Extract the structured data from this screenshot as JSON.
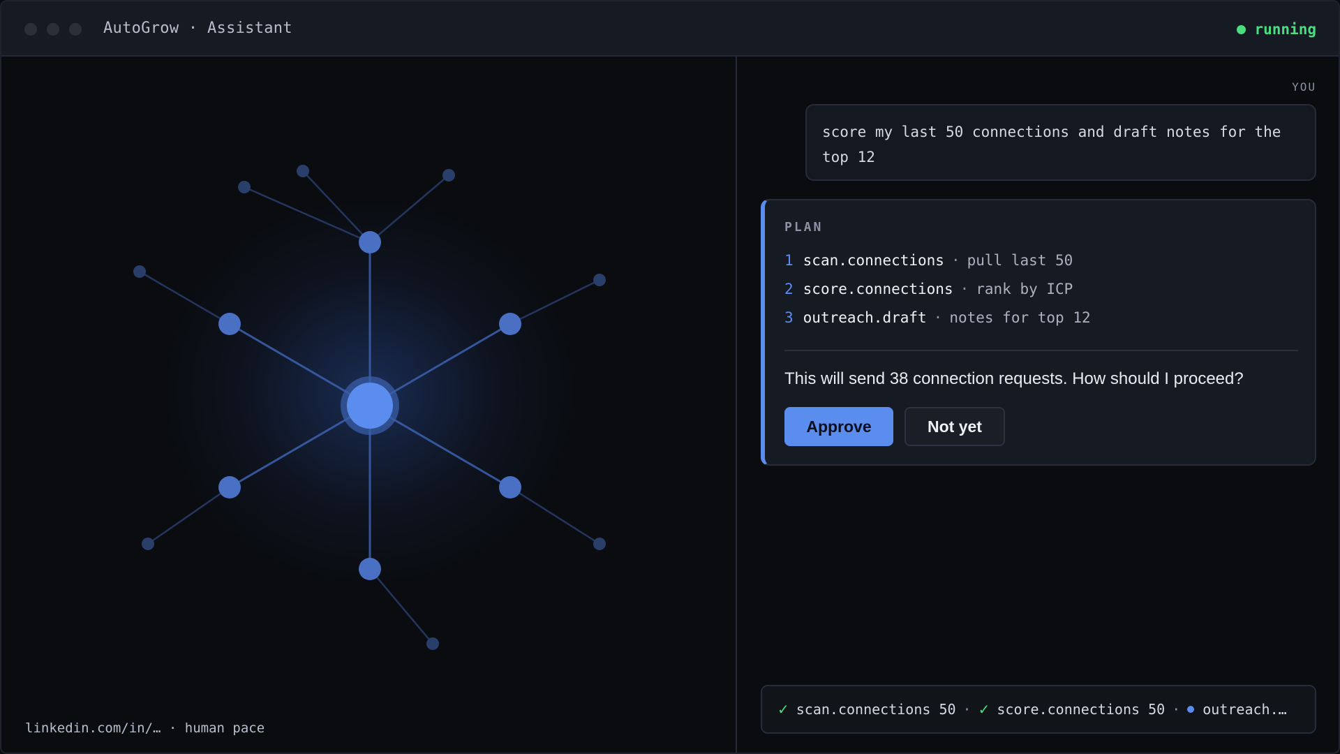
{
  "window": {
    "title": "AutoGrow · Assistant",
    "status": "running",
    "colors": {
      "accent": "#5b8def",
      "status": "#4ade80"
    }
  },
  "left_pane": {
    "footer_note": "linkedin.com/in/… · human pace"
  },
  "chat": {
    "you_label": "YOU",
    "user_message": "score my last 50 connections and draft notes for the top 12",
    "plan": {
      "label": "PLAN",
      "steps": [
        {
          "num": "1",
          "cmd": "scan.connections",
          "sep": "·",
          "desc": "pull last 50"
        },
        {
          "num": "2",
          "cmd": "score.connections",
          "sep": "·",
          "desc": "rank by ICP"
        },
        {
          "num": "3",
          "cmd": "outreach.draft",
          "sep": "·",
          "desc": "notes for top 12"
        }
      ],
      "question": "This will send 38 connection requests. How should I proceed?",
      "approve_label": "Approve",
      "not_yet_label": "Not yet"
    },
    "progress": {
      "items": [
        {
          "icon": "check-icon",
          "mark": "✓",
          "text": "scan.connections 50"
        },
        {
          "icon": "check-icon",
          "mark": "✓",
          "text": "score.connections 50"
        },
        {
          "icon": "pending-dot-icon",
          "text": "outreach.…"
        }
      ],
      "separator": "·"
    }
  }
}
